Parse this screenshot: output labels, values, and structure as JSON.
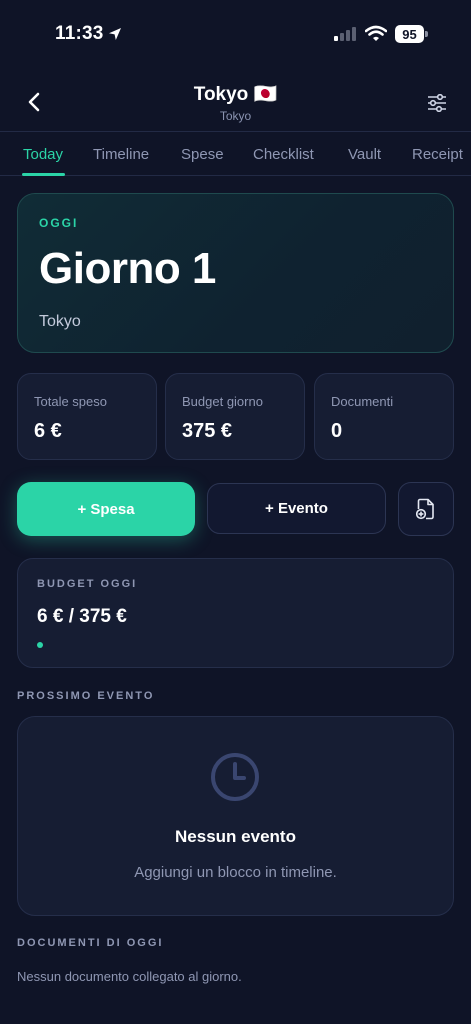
{
  "status_bar": {
    "time": "11:33",
    "battery": "95",
    "signal_bars_active": 1,
    "signal_bars_total": 4
  },
  "header": {
    "title": "Tokyo 🇯🇵",
    "subtitle": "Tokyo"
  },
  "tabs": [
    {
      "label": "Today",
      "active": true
    },
    {
      "label": "Timeline",
      "active": false
    },
    {
      "label": "Spese",
      "active": false
    },
    {
      "label": "Checklist",
      "active": false
    },
    {
      "label": "Vault",
      "active": false
    },
    {
      "label": "Receipt",
      "active": false
    }
  ],
  "hero": {
    "label": "OGGI",
    "title": "Giorno 1",
    "place": "Tokyo"
  },
  "stats": [
    {
      "label": "Totale speso",
      "value": "6 €"
    },
    {
      "label": "Budget giorno",
      "value": "375 €"
    },
    {
      "label": "Documenti",
      "value": "0"
    }
  ],
  "actions": {
    "add_expense": "+ Spesa",
    "add_event": "+ Evento"
  },
  "budget": {
    "label": "BUDGET OGGI",
    "value": "6 € / 375 €",
    "progress_fraction": 0.016
  },
  "next_event": {
    "section_label": "PROSSIMO EVENTO",
    "empty_title": "Nessun evento",
    "empty_subtitle": "Aggiungi un blocco in timeline."
  },
  "documents": {
    "section_label": "DOCUMENTI DI OGGI",
    "empty_text": "Nessun documento collegato al giorno."
  },
  "colors": {
    "background": "#0f1427",
    "accent": "#2bd4a7",
    "card": "#161d33",
    "muted_text": "#8f97b3"
  },
  "icons": {
    "back": "chevron-left-icon",
    "filter": "sliders-icon",
    "document_add": "file-plus-icon",
    "clock": "clock-icon",
    "location": "location-arrow-icon",
    "wifi": "wifi-icon"
  }
}
